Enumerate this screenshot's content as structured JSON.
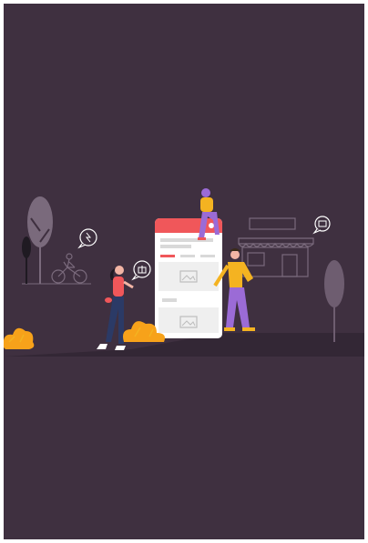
{
  "screen": {
    "background": "#3f3040"
  },
  "illustration": {
    "accent_red": "#f0575a",
    "accent_yellow": "#f4b321",
    "accent_purple": "#9b6bd6",
    "accent_orange": "#f7a21a",
    "line_color": "#7a6a7c",
    "icons": [
      "tree-icon",
      "bicycle-icon",
      "shop-icon",
      "chat-bubble-icon",
      "gift-icon",
      "person-icon",
      "phone-mockup-icon",
      "image-placeholder-icon",
      "bush-icon"
    ]
  }
}
